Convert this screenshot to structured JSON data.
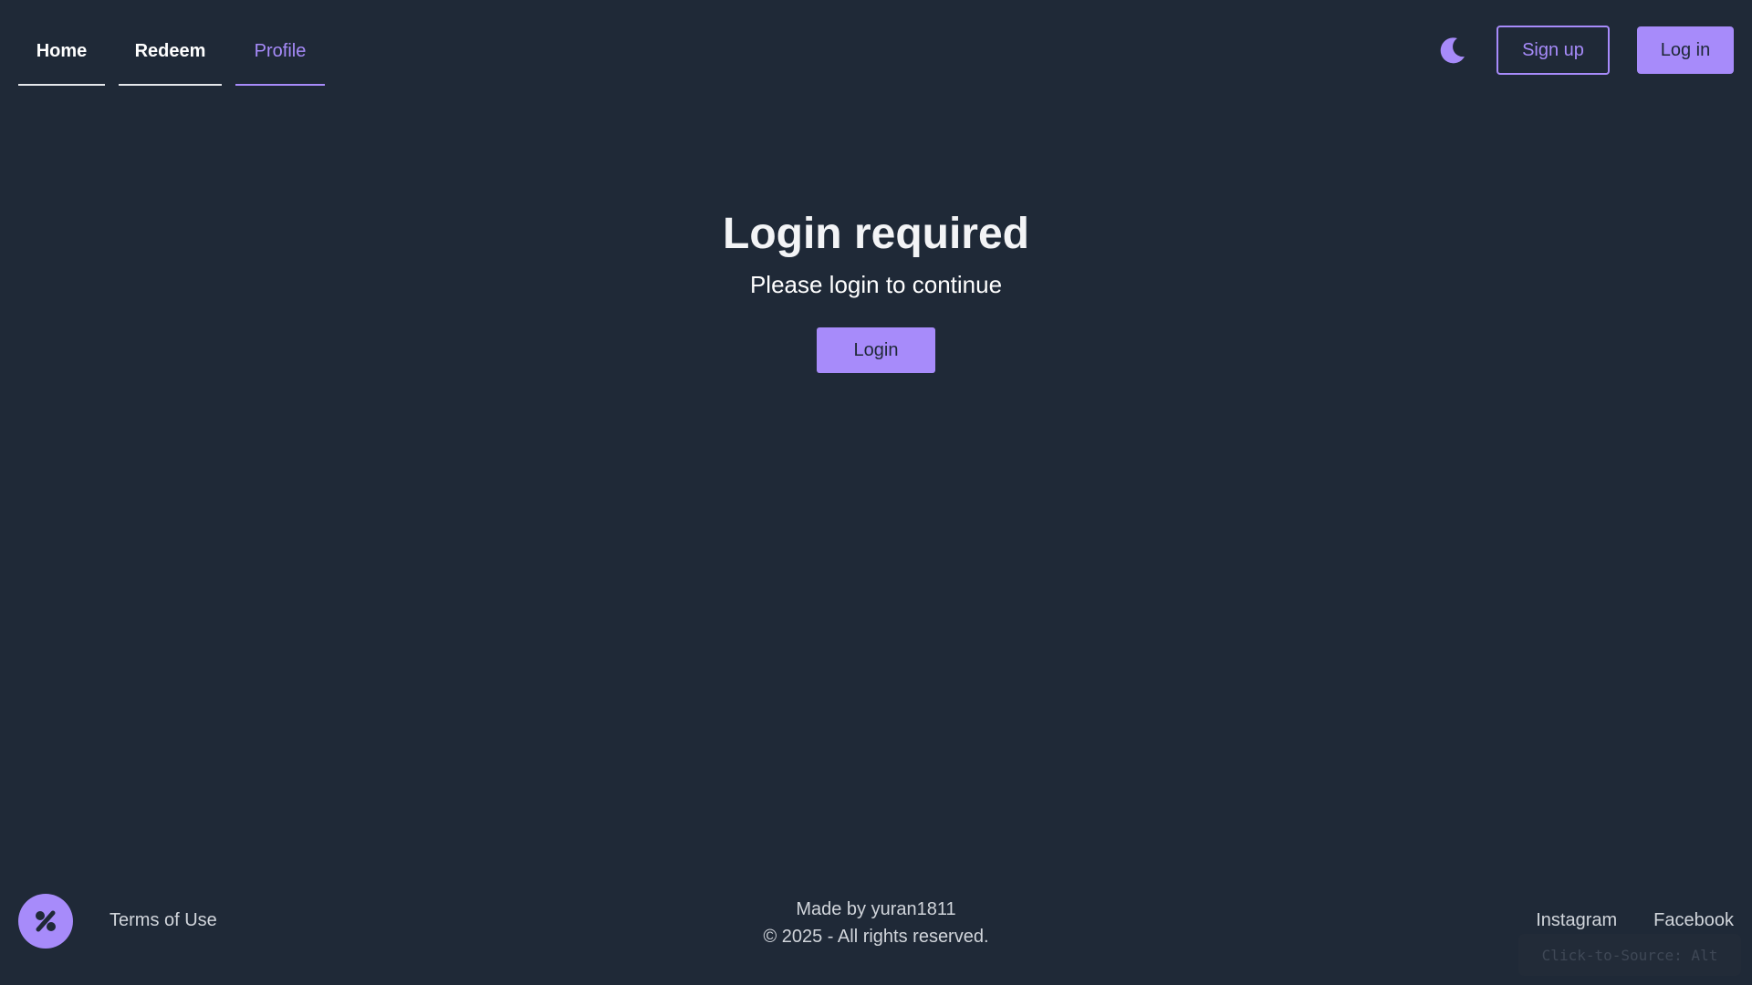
{
  "nav": {
    "tabs": [
      {
        "label": "Home",
        "active": false
      },
      {
        "label": "Redeem",
        "active": false
      },
      {
        "label": "Profile",
        "active": true
      }
    ]
  },
  "header": {
    "theme_icon": "moon-icon",
    "signup_label": "Sign up",
    "login_label": "Log in"
  },
  "main": {
    "title": "Login required",
    "subtitle": "Please login to continue",
    "login_button": "Login"
  },
  "footer": {
    "logo_icon": "percent-icon",
    "terms_label": "Terms of Use",
    "made_by": "Made by yuran1811",
    "copyright": "© 2025 - All rights reserved.",
    "links": [
      "Instagram",
      "Facebook"
    ]
  },
  "overlay": {
    "source_hint": "Click-to-Source: Alt"
  },
  "colors": {
    "background": "#1f2937",
    "accent": "#a78bfa",
    "text": "#ffffff",
    "muted": "#d1d5db"
  }
}
